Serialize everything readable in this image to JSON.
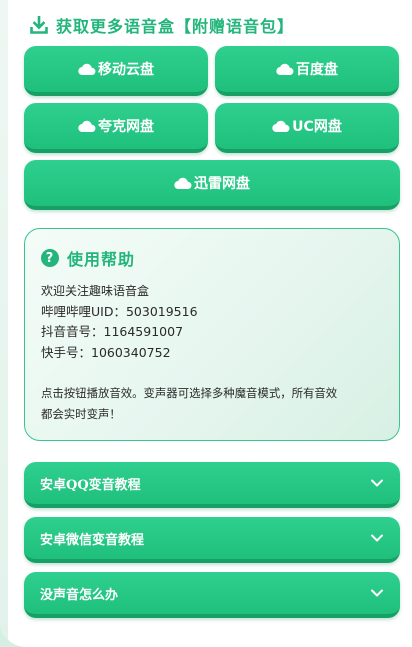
{
  "header": {
    "title": "获取更多语音盒【附赠语音包】"
  },
  "download_buttons": [
    {
      "label": "移动云盘"
    },
    {
      "label": "百度盘"
    },
    {
      "label": "夸克网盘"
    },
    {
      "label": "UC网盘"
    },
    {
      "label": "迅雷网盘"
    }
  ],
  "help": {
    "title": "使用帮助",
    "lines": [
      "欢迎关注趣味语音盒",
      "哔哩哔哩UID：503019516",
      "抖音音号：1164591007",
      "快手号：1060340752",
      "点击按钮播放音效。变声器可选择多种魔音模式，所有音效",
      "都会实时变声！"
    ]
  },
  "accordions": [
    {
      "label": "安卓QQ变音教程"
    },
    {
      "label": "安卓微信变音教程"
    },
    {
      "label": "没声音怎么办"
    }
  ],
  "colors": {
    "accent": "#23b57b",
    "button": "#1fbf7c",
    "button_shadow": "#17a066"
  }
}
